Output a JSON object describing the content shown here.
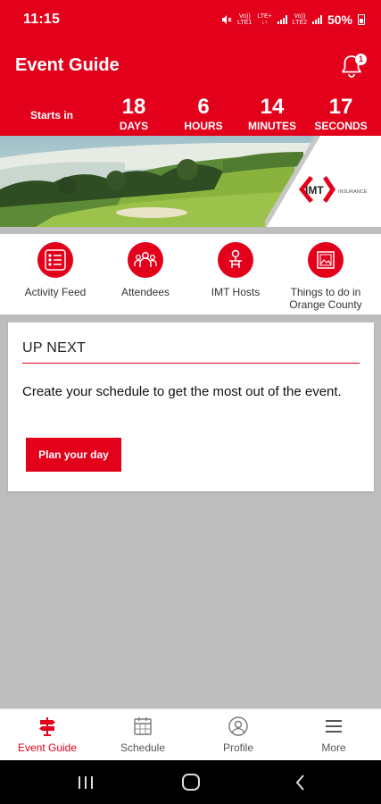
{
  "status_bar": {
    "time": "11:15",
    "battery": "50%",
    "network_labels": [
      "Vo))",
      "LTE1",
      "LTE+",
      "LTE2"
    ]
  },
  "header": {
    "title": "Event Guide",
    "notification_count": "1"
  },
  "countdown": {
    "starts_in_label": "Starts in",
    "days": {
      "value": "18",
      "label": "DAYS"
    },
    "hours": {
      "value": "6",
      "label": "HOURS"
    },
    "minutes": {
      "value": "14",
      "label": "MINUTES"
    },
    "seconds": {
      "value": "17",
      "label": "SECONDS"
    }
  },
  "banner": {
    "logo_text": "IMT",
    "logo_subtext": "INSURANCE"
  },
  "quick_links": [
    {
      "label": "Activity Feed",
      "icon": "activity-feed-icon"
    },
    {
      "label": "Attendees",
      "icon": "attendees-icon"
    },
    {
      "label": "IMT Hosts",
      "icon": "hosts-icon"
    },
    {
      "label": "Things to do in Orange County",
      "icon": "map-image-icon"
    }
  ],
  "up_next": {
    "title": "UP NEXT",
    "message": "Create your schedule to get the most out of the event.",
    "button_label": "Plan your day"
  },
  "tab_bar": [
    {
      "label": "Event Guide",
      "icon": "signpost-icon",
      "active": true
    },
    {
      "label": "Schedule",
      "icon": "calendar-icon",
      "active": false
    },
    {
      "label": "Profile",
      "icon": "profile-icon",
      "active": false
    },
    {
      "label": "More",
      "icon": "menu-icon",
      "active": false
    }
  ],
  "colors": {
    "brand_red": "#e3001b",
    "background_gray": "#bdbdbd"
  }
}
